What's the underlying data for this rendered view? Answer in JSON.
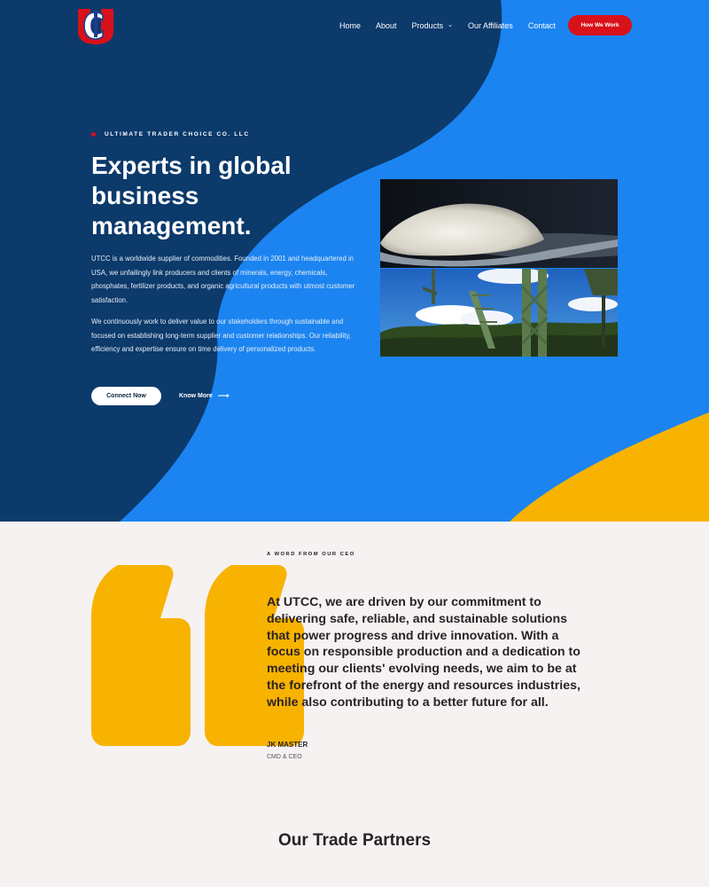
{
  "brand": {
    "logo_text": "UTC",
    "colors": {
      "navy": "#0b3a6b",
      "blue": "#1b84f0",
      "yellow": "#f8b300",
      "red": "#d8111a"
    }
  },
  "nav": {
    "items": [
      {
        "label": "Home"
      },
      {
        "label": "About"
      },
      {
        "label": "Products",
        "has_dropdown": true
      },
      {
        "label": "Our Affiliates"
      },
      {
        "label": "Contact"
      }
    ],
    "cta_label": "How We Work"
  },
  "hero": {
    "eyebrow": "ULTIMATE TRADER CHOICE CO. LLC",
    "headline": "Experts in global business management.",
    "para1": "UTCC is a worldwide supplier of commodities. Founded in 2001 and headquartered in USA, we unfailingly link producers and clients of minerals, energy, chemicals, phosphates, fertilizer products, and organic agricultural products with utmost customer satisfaction.",
    "para2": "We continuously work to deliver value to our stakeholders through sustainable and focused on establishing long-term supplier and customer relationships. Our reliability, efficiency and expertise ensure on time delivery of personalized products.",
    "primary_button": "Connect Now",
    "secondary_button": "Know More",
    "secondary_icon": "arrow-right-icon"
  },
  "ceo": {
    "eyebrow": "A WORD FROM OUR CEO",
    "quote": "At UTCC, we are driven by our commitment to delivering safe, reliable, and sustainable solutions that power progress and drive innovation. With a focus on responsible production and a dedication to meeting our clients' evolving needs, we aim to be at the forefront of the energy and resources industries, while also contributing to a better future for all.",
    "name": "JK MASTER",
    "title": "CMD & CEO"
  },
  "partners": {
    "title": "Our Trade Partners"
  }
}
